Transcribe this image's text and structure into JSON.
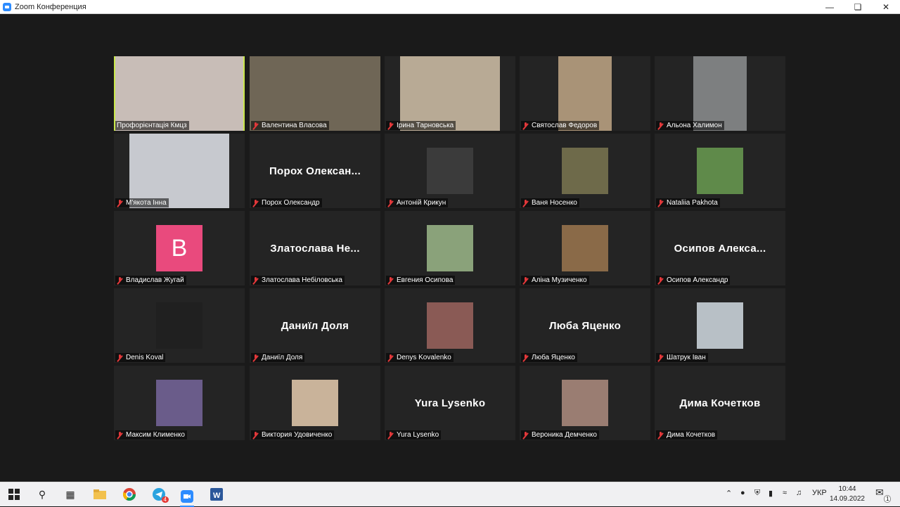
{
  "window": {
    "title": "Zoom Конференция"
  },
  "participants": [
    {
      "name": "Профорієнтація Кмцз",
      "muted": false,
      "video": true,
      "active": true,
      "color": "#c8bdb7"
    },
    {
      "name": "Валентина Власова",
      "muted": true,
      "video": true,
      "color": "#6f6656"
    },
    {
      "name": "Ірина Тарновська",
      "muted": true,
      "video": true,
      "color": "#b8aa95"
    },
    {
      "name": "Святослав Федоров",
      "muted": true,
      "video": true,
      "color": "#a99377"
    },
    {
      "name": "Альона Халимон",
      "muted": true,
      "video": true,
      "color": "#7d7f80"
    },
    {
      "name": "М'якота Інна",
      "muted": true,
      "video": true,
      "color": "#c7c9cf"
    },
    {
      "name": "Порох Олександр",
      "display": "Порох Олексан...",
      "muted": true,
      "video": false
    },
    {
      "name": "Антоній Крикун",
      "muted": true,
      "avatar": true,
      "color": "#3b3b3b"
    },
    {
      "name": "Ваня Носенко",
      "muted": true,
      "avatar": true,
      "color": "#6e6a4a"
    },
    {
      "name": "Nataliia Pakhota",
      "muted": true,
      "avatar": true,
      "color": "#5f8a4a"
    },
    {
      "name": "Владислав Жугай",
      "muted": true,
      "letter": "B",
      "color": "#e94a7d"
    },
    {
      "name": "Златослава Небіловська",
      "display": "Златослава Не...",
      "muted": true,
      "video": false
    },
    {
      "name": "Евгения Осипова",
      "muted": true,
      "avatar": true,
      "color": "#8aa27a"
    },
    {
      "name": "Аліна Музиченко",
      "muted": true,
      "avatar": true,
      "color": "#8a6a48"
    },
    {
      "name": "Осипов Александр",
      "display": "Осипов Алекса...",
      "muted": true,
      "video": false
    },
    {
      "name": "Denis Koval",
      "muted": true,
      "avatar": true,
      "color": "#202020"
    },
    {
      "name": "Даниїл Доля",
      "display": "Даниїл Доля",
      "muted": true,
      "video": false
    },
    {
      "name": "Denys Kovalenko",
      "muted": true,
      "avatar": true,
      "color": "#8a5a55"
    },
    {
      "name": "Люба Яценко",
      "display": "Люба Яценко",
      "muted": true,
      "video": false
    },
    {
      "name": "Шатрук Іван",
      "muted": true,
      "avatar": true,
      "color": "#b8c0c6"
    },
    {
      "name": "Максим Клименко",
      "muted": true,
      "avatar": true,
      "color": "#6a5c8a"
    },
    {
      "name": "Виктория Удовиченко",
      "muted": true,
      "avatar": true,
      "color": "#c9b39a"
    },
    {
      "name": "Yura Lysenko",
      "display": "Yura Lysenko",
      "muted": true,
      "video": false
    },
    {
      "name": "Вероника Демченко",
      "muted": true,
      "avatar": true,
      "color": "#9a7d72"
    },
    {
      "name": "Дима Кочетков",
      "display": "Дима Кочетков",
      "muted": true,
      "video": false
    }
  ],
  "taskbar": {
    "lang": "УКР",
    "time": "10:44",
    "date": "14.09.2022",
    "telegram_badge": "4",
    "notifications": "1"
  }
}
